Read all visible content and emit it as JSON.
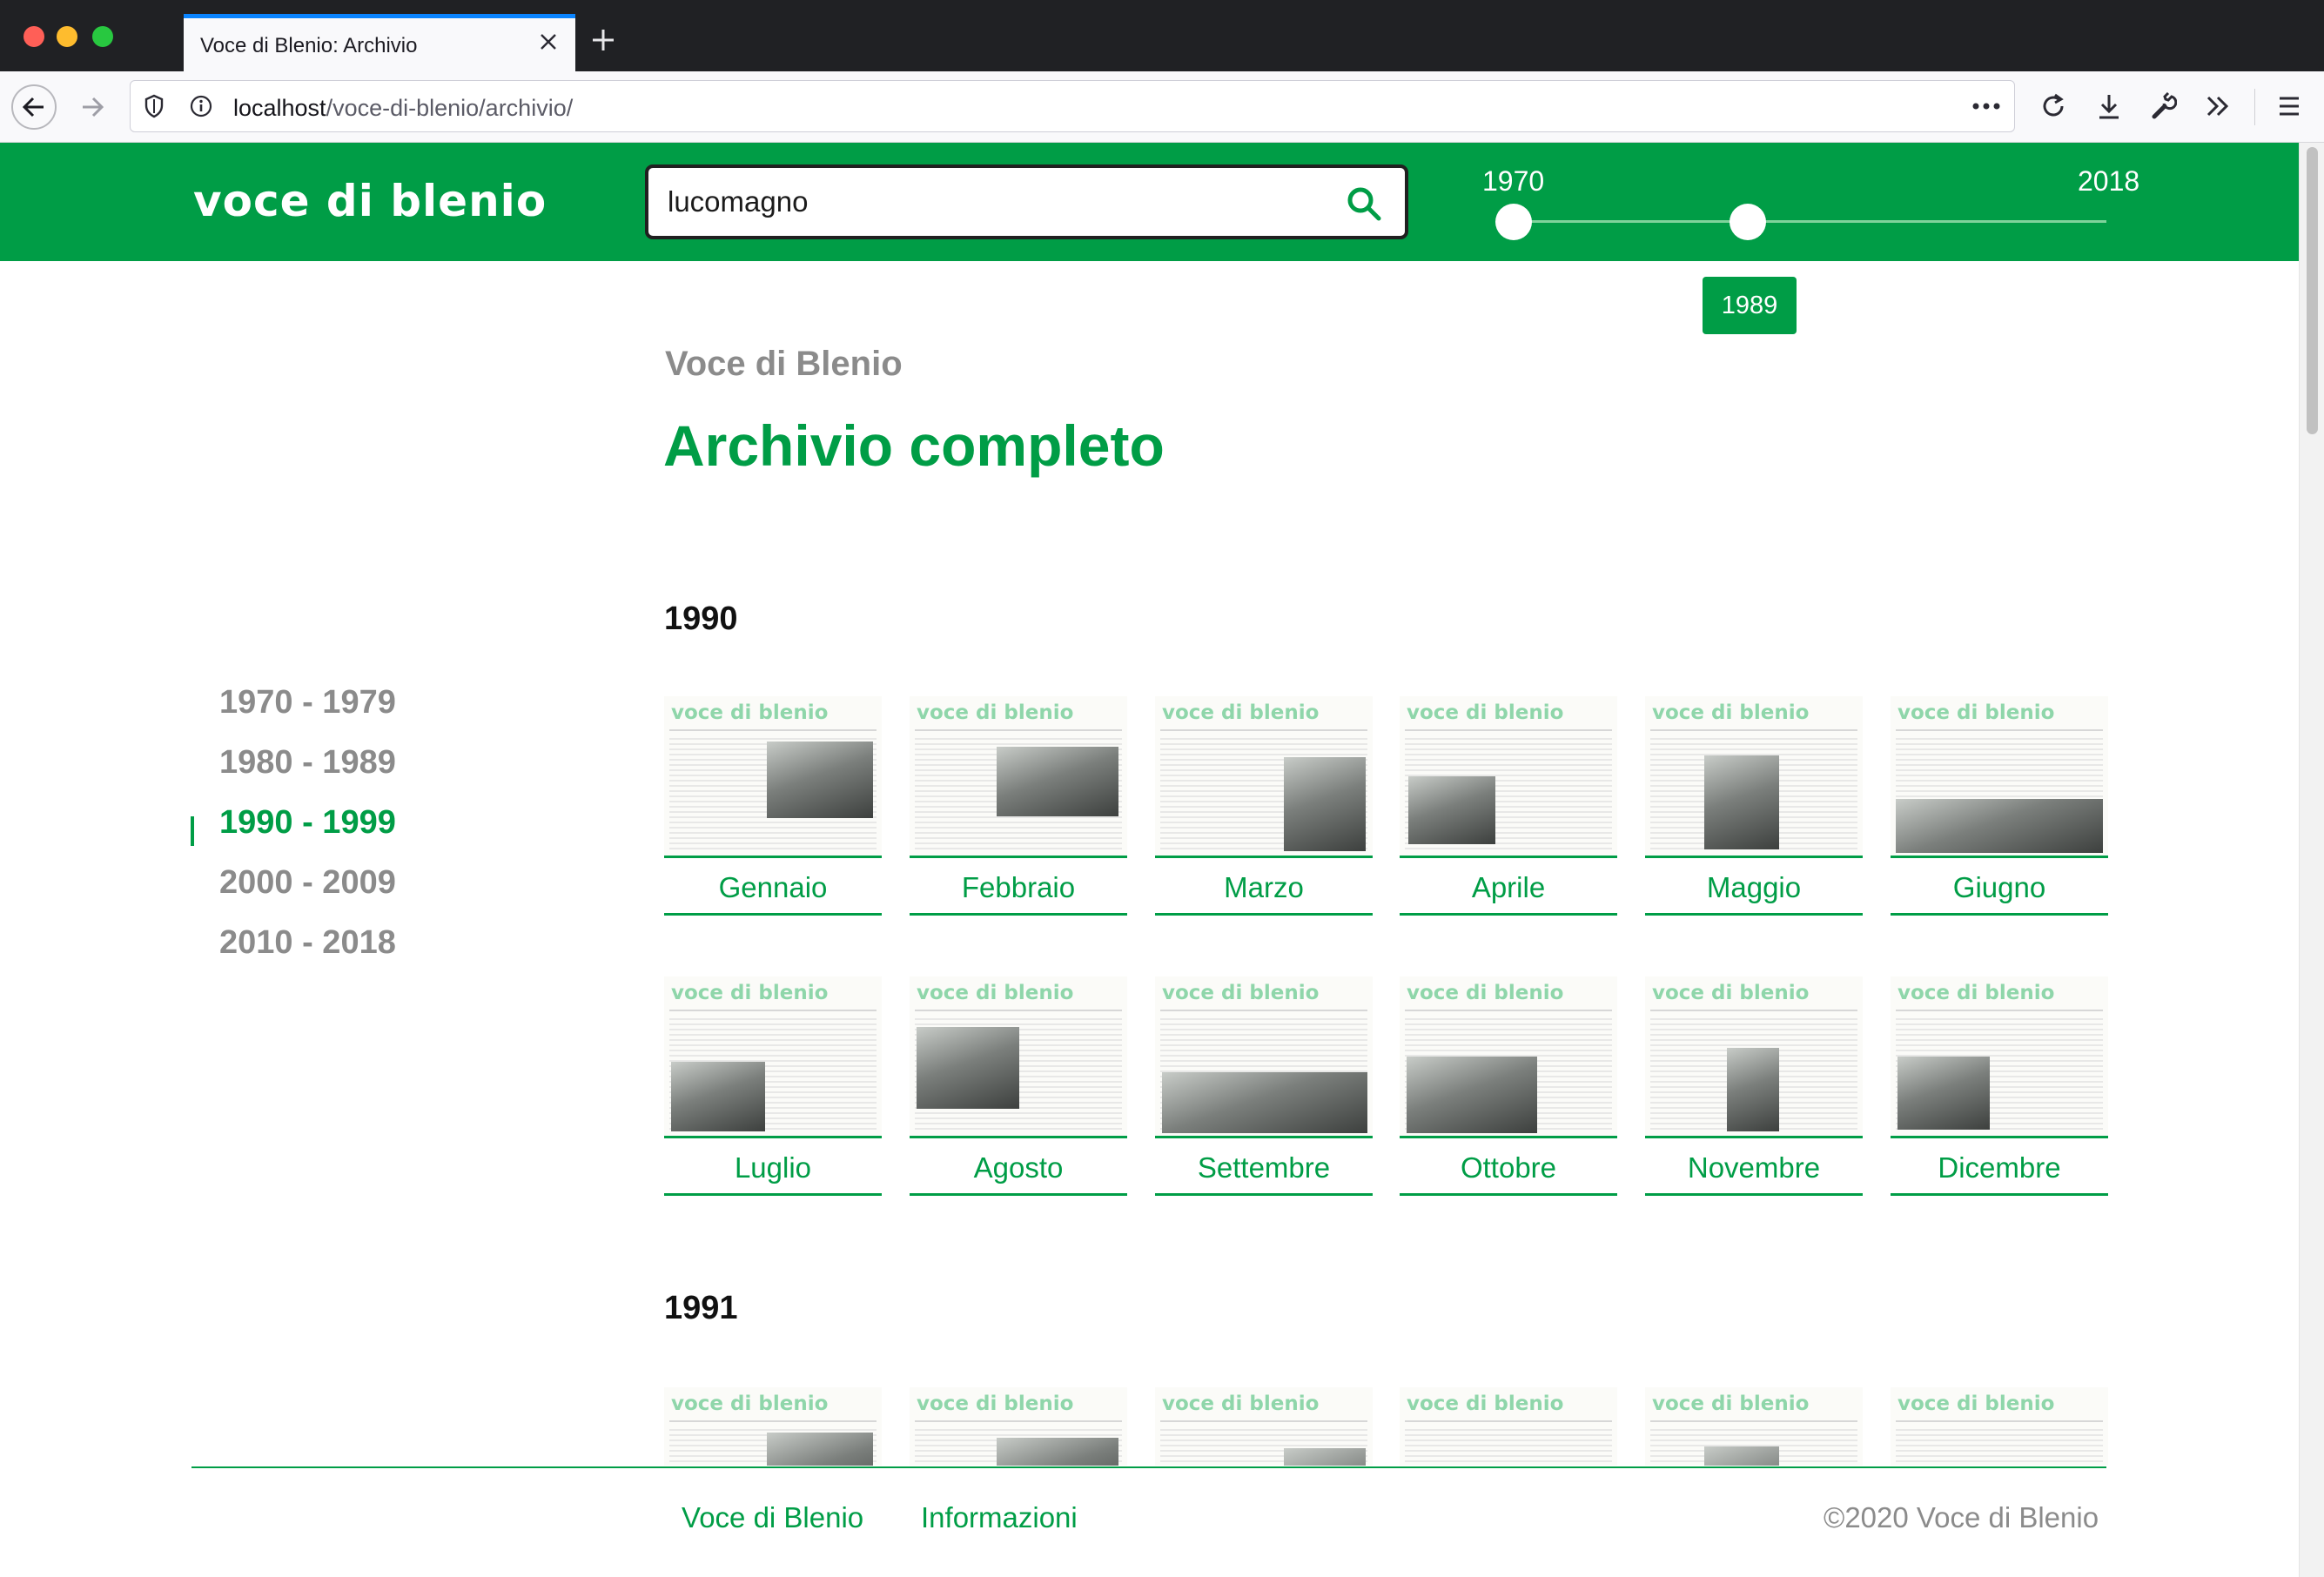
{
  "browser": {
    "tab_title": "Voce di Blenio: Archivio",
    "url_host": "localhost",
    "url_path": "/voce-di-blenio/archivio/",
    "accent_color": "#0a84ff"
  },
  "header": {
    "logo": "voce di blenio",
    "search": {
      "value": "lucomagno",
      "placeholder": ""
    },
    "slider": {
      "min_label": "1970",
      "max_label": "2018",
      "selected_max": "1989"
    },
    "brand_color": "#009d46"
  },
  "main": {
    "kicker": "Voce di Blenio",
    "title": "Archivio completo"
  },
  "decades": [
    {
      "label": "1970 - 1979",
      "active": false
    },
    {
      "label": "1980 - 1989",
      "active": false
    },
    {
      "label": "1990 - 1999",
      "active": true
    },
    {
      "label": "2000 - 2009",
      "active": false
    },
    {
      "label": "2010 - 2018",
      "active": false
    }
  ],
  "years": [
    {
      "year": "1990",
      "months": [
        "Gennaio",
        "Febbraio",
        "Marzo",
        "Aprile",
        "Maggio",
        "Giugno",
        "Luglio",
        "Agosto",
        "Settembre",
        "Ottobre",
        "Novembre",
        "Dicembre"
      ]
    },
    {
      "year": "1991"
    }
  ],
  "footer": {
    "links": [
      "Voce di Blenio",
      "Informazioni"
    ],
    "copyright": "©2020 Voce di Blenio"
  },
  "icons": [
    "back-arrow-icon",
    "forward-arrow-icon",
    "shield-icon",
    "info-icon",
    "more-icon",
    "reload-icon",
    "download-icon",
    "wrench-icon",
    "chevrons-icon",
    "menu-icon",
    "search-icon",
    "close-icon",
    "plus-icon"
  ]
}
